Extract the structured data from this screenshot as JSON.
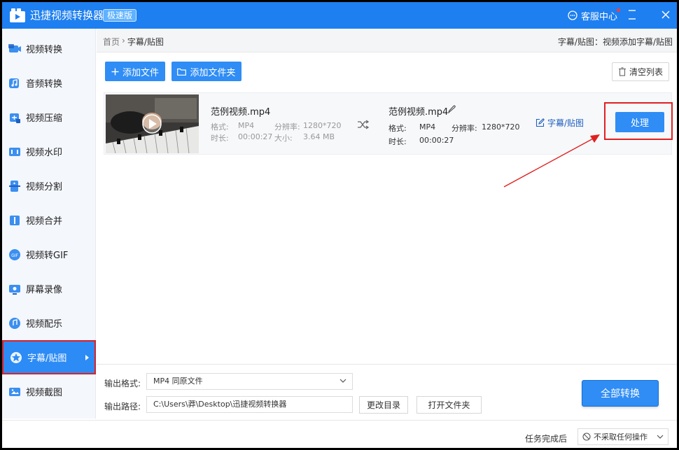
{
  "app": {
    "title": "迅捷视频转换器",
    "edition": "极速版",
    "service_label": "客服中心"
  },
  "sidebar": {
    "items": [
      {
        "label": "视频转换",
        "icon": "video-convert-icon"
      },
      {
        "label": "音频转换",
        "icon": "audio-convert-icon"
      },
      {
        "label": "视频压缩",
        "icon": "video-compress-icon"
      },
      {
        "label": "视频水印",
        "icon": "video-watermark-icon"
      },
      {
        "label": "视频分割",
        "icon": "video-split-icon"
      },
      {
        "label": "视频合并",
        "icon": "video-merge-icon"
      },
      {
        "label": "视频转GIF",
        "icon": "video-gif-icon"
      },
      {
        "label": "屏幕录像",
        "icon": "screen-record-icon"
      },
      {
        "label": "视频配乐",
        "icon": "video-music-icon"
      },
      {
        "label": "字幕/贴图",
        "icon": "subtitle-sticker-icon",
        "active": true
      },
      {
        "label": "视频截图",
        "icon": "video-screenshot-icon"
      }
    ]
  },
  "breadcrumb": {
    "home": "首页",
    "separator": "›",
    "current": "字幕/贴图",
    "right_text": "字幕/贴图：视频添加字幕/贴图"
  },
  "toolbar": {
    "add_file": "添加文件",
    "add_folder": "添加文件夹",
    "clear_list": "清空列表"
  },
  "file": {
    "source": {
      "name": "范例视频.mp4",
      "format_label": "格式:",
      "format": "MP4",
      "resolution_label": "分辨率:",
      "resolution": "1280*720",
      "duration_label": "时长:",
      "duration": "00:00:27",
      "size_label": "大小:",
      "size": "3.64 MB"
    },
    "output": {
      "name": "范例视频.mp4",
      "format_label": "格式:",
      "format": "MP4",
      "resolution_label": "分辨率:",
      "resolution": "1280*720",
      "duration_label": "时长:",
      "duration": "00:00:27"
    },
    "edit_label": "字幕/贴图",
    "process_label": "处理"
  },
  "bottom": {
    "format_label": "输出格式:",
    "format_value": "MP4  同原文件",
    "path_label": "输出路径:",
    "path_value": "C:\\Users\\莽\\Desktop\\迅捷视频转换器",
    "change_dir": "更改目录",
    "open_folder": "打开文件夹",
    "convert_all": "全部转换"
  },
  "status": {
    "after_label": "任务完成后",
    "after_value": "不采取任何操作"
  },
  "colors": {
    "primary": "#2f8df5",
    "titlebar": "#1e7ff0",
    "highlight_red": "#e02020"
  }
}
